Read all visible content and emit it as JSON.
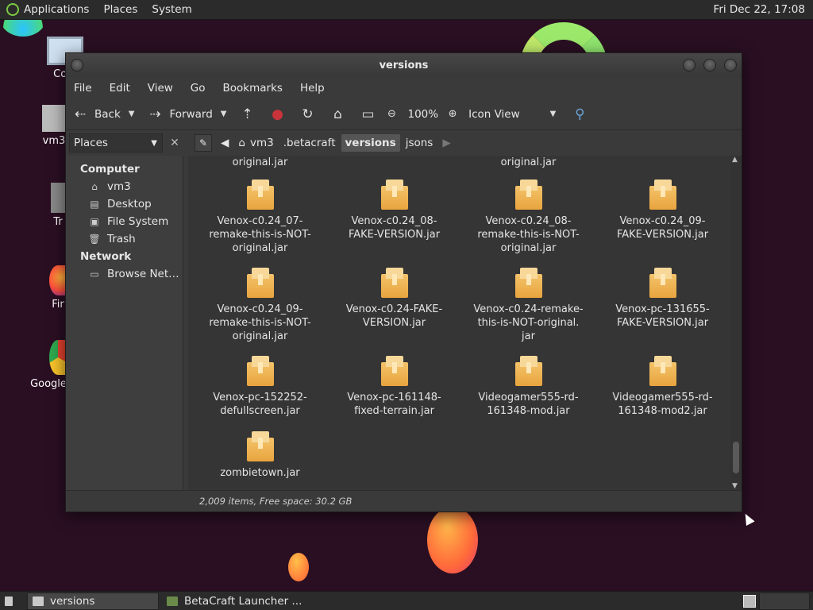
{
  "top_panel": {
    "menus": [
      "Applications",
      "Places",
      "System"
    ],
    "clock": "Fri Dec 22, 17:08"
  },
  "desktop_icons": [
    {
      "label": "Com",
      "icon": "computer-icon"
    },
    {
      "label": "vm3",
      "icon": "home-folder-icon"
    },
    {
      "label": "Tr",
      "icon": "trash-icon"
    },
    {
      "label": "Fir",
      "icon": "firefox-icon"
    },
    {
      "label": "Google",
      "icon": "chrome-icon"
    }
  ],
  "window": {
    "title": "versions",
    "menubar": [
      "File",
      "Edit",
      "View",
      "Go",
      "Bookmarks",
      "Help"
    ],
    "toolbar": {
      "back": "Back",
      "forward": "Forward",
      "zoom": "100%",
      "view_mode": "Icon View"
    },
    "places_combo": "Places",
    "breadcrumbs": [
      "vm3",
      ".betacraft",
      "versions",
      "jsons"
    ],
    "active_crumb": "versions",
    "sidebar": {
      "sections": [
        {
          "heading": "Computer",
          "items": [
            {
              "label": "vm3",
              "icon": "home-folder-icon"
            },
            {
              "label": "Desktop",
              "icon": "desktop-folder-icon"
            },
            {
              "label": "File System",
              "icon": "drive-icon"
            },
            {
              "label": "Trash",
              "icon": "trash-icon"
            }
          ]
        },
        {
          "heading": "Network",
          "items": [
            {
              "label": "Browse Net…",
              "icon": "network-icon"
            }
          ]
        }
      ]
    },
    "files": [
      {
        "name": "original.jar",
        "partial": true,
        "col": 0
      },
      {
        "name": "original.jar",
        "partial": true,
        "col": 2
      },
      {
        "name": "Venox-c0.24_07-remake-this-is-NOT-original.jar",
        "lines": [
          "Venox-c0.24_07-",
          "remake-this-is-NOT-",
          "original.jar"
        ]
      },
      {
        "name": "Venox-c0.24_08-FAKE-VERSION.jar",
        "lines": [
          "Venox-c0.24_08-",
          "FAKE-VERSION.jar"
        ]
      },
      {
        "name": "Venox-c0.24_08-remake-this-is-NOT-original.jar",
        "lines": [
          "Venox-c0.24_08-",
          "remake-this-is-NOT-",
          "original.jar"
        ]
      },
      {
        "name": "Venox-c0.24_09-FAKE-VERSION.jar",
        "lines": [
          "Venox-c0.24_09-",
          "FAKE-VERSION.jar"
        ]
      },
      {
        "name": "Venox-c0.24_09-remake-this-is-NOT-original.jar",
        "lines": [
          "Venox-c0.24_09-",
          "remake-this-is-NOT-",
          "original.jar"
        ]
      },
      {
        "name": "Venox-c0.24-FAKE-VERSION.jar",
        "lines": [
          "Venox-c0.24-FAKE-",
          "VERSION.jar"
        ]
      },
      {
        "name": "Venox-c0.24-remake-this-is-NOT-original.jar",
        "lines": [
          "Venox-c0.24-remake-",
          "this-is-NOT-original.",
          "jar"
        ]
      },
      {
        "name": "Venox-pc-131655-FAKE-VERSION.jar",
        "lines": [
          "Venox-pc-131655-",
          "FAKE-VERSION.jar"
        ]
      },
      {
        "name": "Venox-pc-152252-defullscreen.jar",
        "lines": [
          "Venox-pc-152252-",
          "defullscreen.jar"
        ]
      },
      {
        "name": "Venox-pc-161148-fixed-terrain.jar",
        "lines": [
          "Venox-pc-161148-",
          "fixed-terrain.jar"
        ]
      },
      {
        "name": "Videogamer555-rd-161348-mod.jar",
        "lines": [
          "Videogamer555-rd-",
          "161348-mod.jar"
        ]
      },
      {
        "name": "Videogamer555-rd-161348-mod2.jar",
        "lines": [
          "Videogamer555-rd-",
          "161348-mod2.jar"
        ]
      },
      {
        "name": "zombietown.jar",
        "lines": [
          "zombietown.jar"
        ]
      }
    ],
    "status": "2,009 items, Free space: 30.2 GB"
  },
  "taskbar": {
    "tasks": [
      {
        "label": "versions",
        "active": true
      },
      {
        "label": "BetaCraft Launcher ...",
        "active": false
      }
    ]
  }
}
